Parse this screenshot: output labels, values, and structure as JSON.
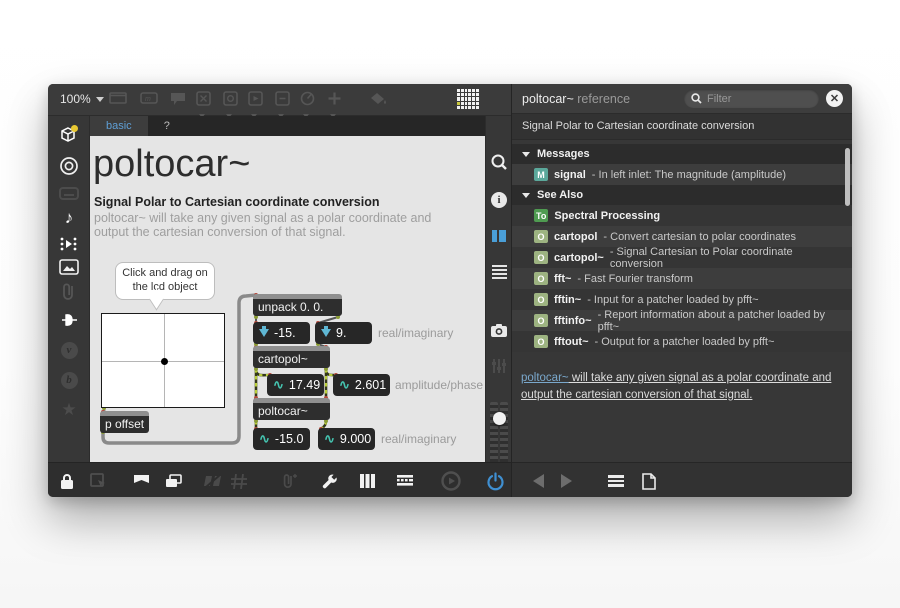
{
  "window": {
    "zoom_level": "100%",
    "tabs": [
      {
        "label": "basic",
        "active": true
      },
      {
        "label": "?",
        "active": false
      }
    ]
  },
  "patcher": {
    "title": "poltocar~",
    "subtitle": "Signal Polar to Cartesian coordinate conversion",
    "description": "poltocar~ will take any given signal as a polar coordinate and output the cartesian conversion of that signal.",
    "bubble_text": "Click and drag on the lcd object",
    "objects": {
      "p_offset": "p offset",
      "unpack": "unpack 0. 0.",
      "cartopol": "cartopol~",
      "poltocar": "poltocar~",
      "flonum_real": "-15.",
      "flonum_imag": "9.",
      "sig_amplitude": "17.49",
      "sig_phase": "2.601",
      "sig_real": "-15.0",
      "sig_imag": "9.000",
      "label_real_imaginary_top": "real/imaginary",
      "label_amplitude_phase": "amplitude/phase",
      "label_real_imaginary_bottom": "real/imaginary"
    }
  },
  "reference": {
    "title": "poltocar~",
    "title_suffix": "reference",
    "filter_placeholder": "Filter",
    "summary": "Signal Polar to Cartesian coordinate conversion",
    "sections": [
      {
        "label": "Messages",
        "items": [
          {
            "badge": "M",
            "badge_color": "#5ba89b",
            "name": "signal",
            "desc": "In left inlet: The magnitude (amplitude)"
          }
        ]
      },
      {
        "label": "See Also",
        "items": [
          {
            "badge": "To",
            "badge_color": "#4f9b51",
            "name": "Spectral Processing",
            "desc": ""
          },
          {
            "badge": "O",
            "badge_color": "#9db381",
            "name": "cartopol",
            "desc": "Convert cartesian to polar coordinates"
          },
          {
            "badge": "O",
            "badge_color": "#9db381",
            "name": "cartopol~",
            "desc": "Signal Cartesian to Polar coordinate conversion"
          },
          {
            "badge": "O",
            "badge_color": "#9db381",
            "name": "fft~",
            "desc": "Fast Fourier transform"
          },
          {
            "badge": "O",
            "badge_color": "#9db381",
            "name": "fftin~",
            "desc": "Input for a patcher loaded by pfft~"
          },
          {
            "badge": "O",
            "badge_color": "#9db381",
            "name": "fftinfo~",
            "desc": "Report information about a patcher loaded by pfft~"
          },
          {
            "badge": "O",
            "badge_color": "#9db381",
            "name": "fftout~",
            "desc": "Output for a patcher loaded by pfft~"
          }
        ]
      }
    ],
    "blurb_link": "poltocar~",
    "blurb_rest": " will take any given signal as a polar coordinate and output the cartesian conversion of that signal."
  },
  "colors": {
    "accent_blue": "#4a9fd8",
    "tab_active_text": "#5f9fd6",
    "signal_teal": "#45c4b0",
    "flonum_blue": "#5fb7d4",
    "power_blue": "#3f8fd1"
  }
}
